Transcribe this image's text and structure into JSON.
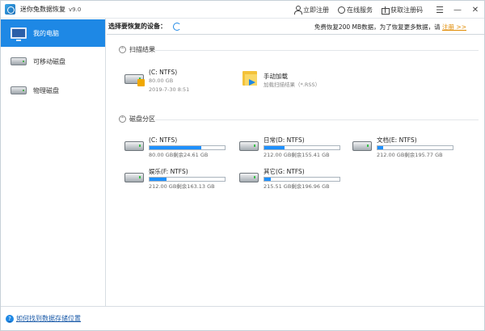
{
  "app": {
    "title": "迷你兔数据恢复",
    "version": "v9.0"
  },
  "titlebar": {
    "register_label": "立即注册",
    "service_label": "在线服务",
    "code_label": "获取注册码",
    "menu_symbol": "☰",
    "minimize_symbol": "—",
    "close_symbol": "✕",
    "icons": [
      "user-icon",
      "headset-icon",
      "gift-icon"
    ]
  },
  "sidebar": {
    "items": [
      {
        "label": "我的电脑",
        "icon": "monitor-icon",
        "active": true
      },
      {
        "label": "可移动磁盘",
        "icon": "hdd-icon",
        "active": false
      },
      {
        "label": "物理磁盘",
        "icon": "hdd-icon",
        "active": false
      }
    ]
  },
  "header": {
    "select_label": "选择要恢复的设备：",
    "promo_text": "免费恢复200 MB数据，为了恢复更多数据，请",
    "promo_link": "注册 >>"
  },
  "scan_results": {
    "title": "扫描结果",
    "collapse_symbol": "⌃",
    "items": [
      {
        "name": "(C: NTFS)",
        "size": "80.00 GB",
        "date": "2019-7-30 8:51"
      },
      {
        "name": "手动加载",
        "sub": "加载扫描结果（*.RSS）"
      }
    ]
  },
  "partitions": {
    "title": "磁盘分区",
    "collapse_symbol": "⌃",
    "items": [
      {
        "name": "(C: NTFS)",
        "size_text": "80.00 GB剩余24.61 GB",
        "used_fraction": 0.69
      },
      {
        "name": "日常(D: NTFS)",
        "size_text": "212.00 GB剩余155.41 GB",
        "used_fraction": 0.27
      },
      {
        "name": "文档(E: NTFS)",
        "size_text": "212.00 GB剩余195.77 GB",
        "used_fraction": 0.08
      },
      {
        "name": "娱乐(F: NTFS)",
        "size_text": "212.00 GB剩余163.13 GB",
        "used_fraction": 0.23
      },
      {
        "name": "其它(G: NTFS)",
        "size_text": "215.51 GB剩余196.96 GB",
        "used_fraction": 0.09
      }
    ]
  },
  "footer": {
    "help_symbol": "?",
    "help_link": "如何找到数据存储位置"
  },
  "colors": {
    "accent": "#1e88e5",
    "bar_fill": "#1e90ff",
    "promo_link": "#e08a00"
  }
}
